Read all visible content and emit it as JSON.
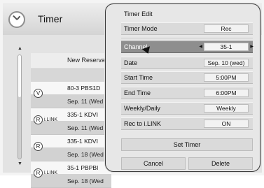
{
  "header": {
    "title": "Timer",
    "icon": "clock-icon"
  },
  "list": {
    "header_text": "New Reserva",
    "rows": [
      {
        "icon": "V",
        "ilink": "",
        "channel": "80-3  PBS1D",
        "date": "Sep. 11 (Wed"
      },
      {
        "icon": "R",
        "ilink": "i.LINK",
        "channel": "335-1  KDVI",
        "date": "Sep. 11 (Wed"
      },
      {
        "icon": "R",
        "ilink": "",
        "channel": "335-1  KDVI",
        "date": "Sep. 18 (Wed"
      },
      {
        "icon": "R",
        "ilink": "i.LINK",
        "channel": "35-1  PBPBI",
        "date": "Sep. 18 (Wed"
      }
    ]
  },
  "dialog": {
    "title": "Timer Edit",
    "fields": [
      {
        "label": "Timer Mode",
        "value": "Rec"
      },
      {
        "label": "Channel",
        "value": "35-1"
      },
      {
        "label": "Date",
        "value": "Sep. 10 (wed)"
      },
      {
        "label": "Start Time",
        "value": "5:00PM"
      },
      {
        "label": "End Time",
        "value": "6:00PM"
      },
      {
        "label": "Weekly/Daily",
        "value": "Weekly"
      },
      {
        "label": "Rec to i.LINK",
        "value": "ON"
      }
    ],
    "set_timer": "Set Timer",
    "cancel": "Cancel",
    "delete": "Delete"
  },
  "colors": {
    "selected_row": "#8e8e8e",
    "dialog_bg": "#e7e7e7"
  }
}
